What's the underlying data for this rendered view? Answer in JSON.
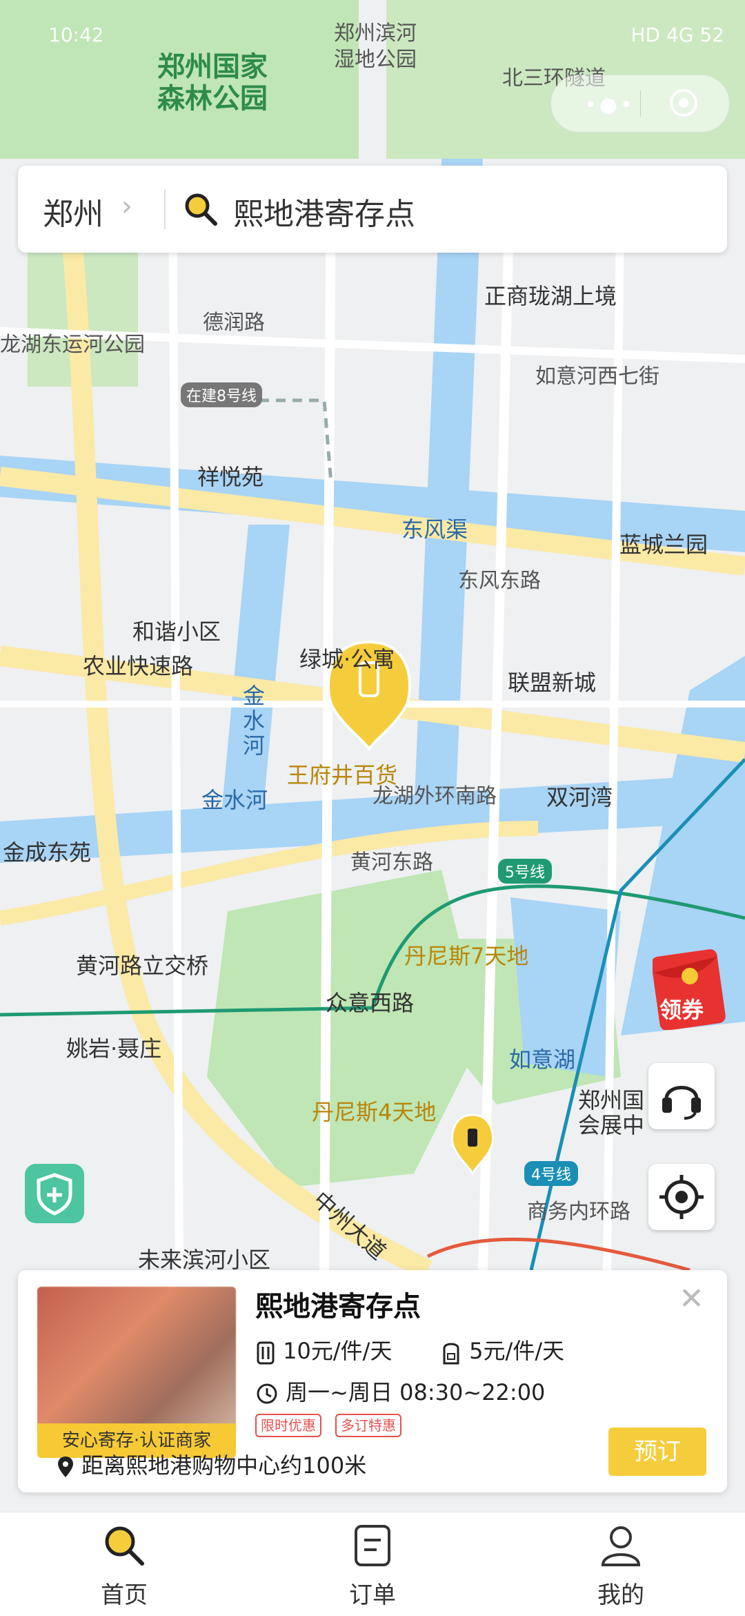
{
  "status_bar": {
    "time": "10:42",
    "right": "HD 4G 52"
  },
  "search": {
    "city": "郑州",
    "query": "熙地港寄存点"
  },
  "map": {
    "labels": [
      {
        "id": "forest-park",
        "text": "郑州国家\n森林公园",
        "cls": "green"
      },
      {
        "id": "wetland",
        "text": "郑州滨河\n湿地公园",
        "cls": "road"
      },
      {
        "id": "tunnel",
        "text": "北三环隧道",
        "cls": "road"
      },
      {
        "id": "zhengshang",
        "text": "正商珑湖上境",
        "cls": ""
      },
      {
        "id": "derun",
        "text": "德润路",
        "cls": "road"
      },
      {
        "id": "longhu-park",
        "text": "龙湖东运河公园",
        "cls": "road"
      },
      {
        "id": "ruyi7",
        "text": "如意河西七街",
        "cls": "road"
      },
      {
        "id": "line8",
        "text": "在建8号线",
        "cls": "road"
      },
      {
        "id": "xiangyue",
        "text": "祥悦苑",
        "cls": ""
      },
      {
        "id": "dongfengqu",
        "text": "东风渠",
        "cls": "blue"
      },
      {
        "id": "lancheng",
        "text": "蓝城兰园",
        "cls": ""
      },
      {
        "id": "dongfeng-e",
        "text": "东风东路",
        "cls": "road"
      },
      {
        "id": "hexie",
        "text": "和谐小区",
        "cls": ""
      },
      {
        "id": "lvcheng",
        "text": "绿城·公寓",
        "cls": ""
      },
      {
        "id": "agri-road",
        "text": "农业快速路",
        "cls": ""
      },
      {
        "id": "lianmeng",
        "text": "联盟新城",
        "cls": ""
      },
      {
        "id": "jinshui-river",
        "text": "金\n水\n河",
        "cls": "blue"
      },
      {
        "id": "wangfujing",
        "text": "王府井百货",
        "cls": "orange"
      },
      {
        "id": "longhu-ring",
        "text": "龙湖外环南路",
        "cls": "road"
      },
      {
        "id": "shuanghe",
        "text": "双河湾",
        "cls": ""
      },
      {
        "id": "jinshui-r2",
        "text": "金水河",
        "cls": "blue"
      },
      {
        "id": "jincheng",
        "text": "金成东苑",
        "cls": ""
      },
      {
        "id": "huanghe-e",
        "text": "黄河东路",
        "cls": "road"
      },
      {
        "id": "line5",
        "text": "5号线",
        "cls": "road"
      },
      {
        "id": "dennis7",
        "text": "丹尼斯7天地",
        "cls": "orange"
      },
      {
        "id": "huanghe-bridge",
        "text": "黄河路立交桥",
        "cls": ""
      },
      {
        "id": "zhongyi",
        "text": "众意西路",
        "cls": ""
      },
      {
        "id": "yaoyan",
        "text": "姚岩·聂庄",
        "cls": ""
      },
      {
        "id": "ruyi-lake",
        "text": "如意湖",
        "cls": "blue"
      },
      {
        "id": "expo",
        "text": "郑州国\n会展中",
        "cls": ""
      },
      {
        "id": "dennis4",
        "text": "丹尼斯4天地",
        "cls": "orange"
      },
      {
        "id": "line4",
        "text": "4号线",
        "cls": "road"
      },
      {
        "id": "business-ring",
        "text": "商务内环路",
        "cls": "road"
      },
      {
        "id": "zhongzhou",
        "text": "中州大道",
        "cls": ""
      },
      {
        "id": "weilai",
        "text": "未来滨河小区",
        "cls": ""
      }
    ]
  },
  "coupon": {
    "label": "领券"
  },
  "card": {
    "name": "熙地港寄存点",
    "badge": "安心寄存·认证商家",
    "price_large": "10元/件/天",
    "price_small": "5元/件/天",
    "hours": "周一~周日 08:30~22:00",
    "tags": [
      "限时优惠",
      "多订特惠"
    ],
    "distance": "距离熙地港购物中心约100米",
    "book": "预订"
  },
  "tabs": [
    {
      "label": "首页"
    },
    {
      "label": "订单"
    },
    {
      "label": "我的"
    }
  ],
  "colors": {
    "accent": "#f5cd3c",
    "tag_red": "#e65050",
    "water": "#a8d4f5",
    "park": "#bfe6b4",
    "road_main": "#fbe9a6"
  }
}
